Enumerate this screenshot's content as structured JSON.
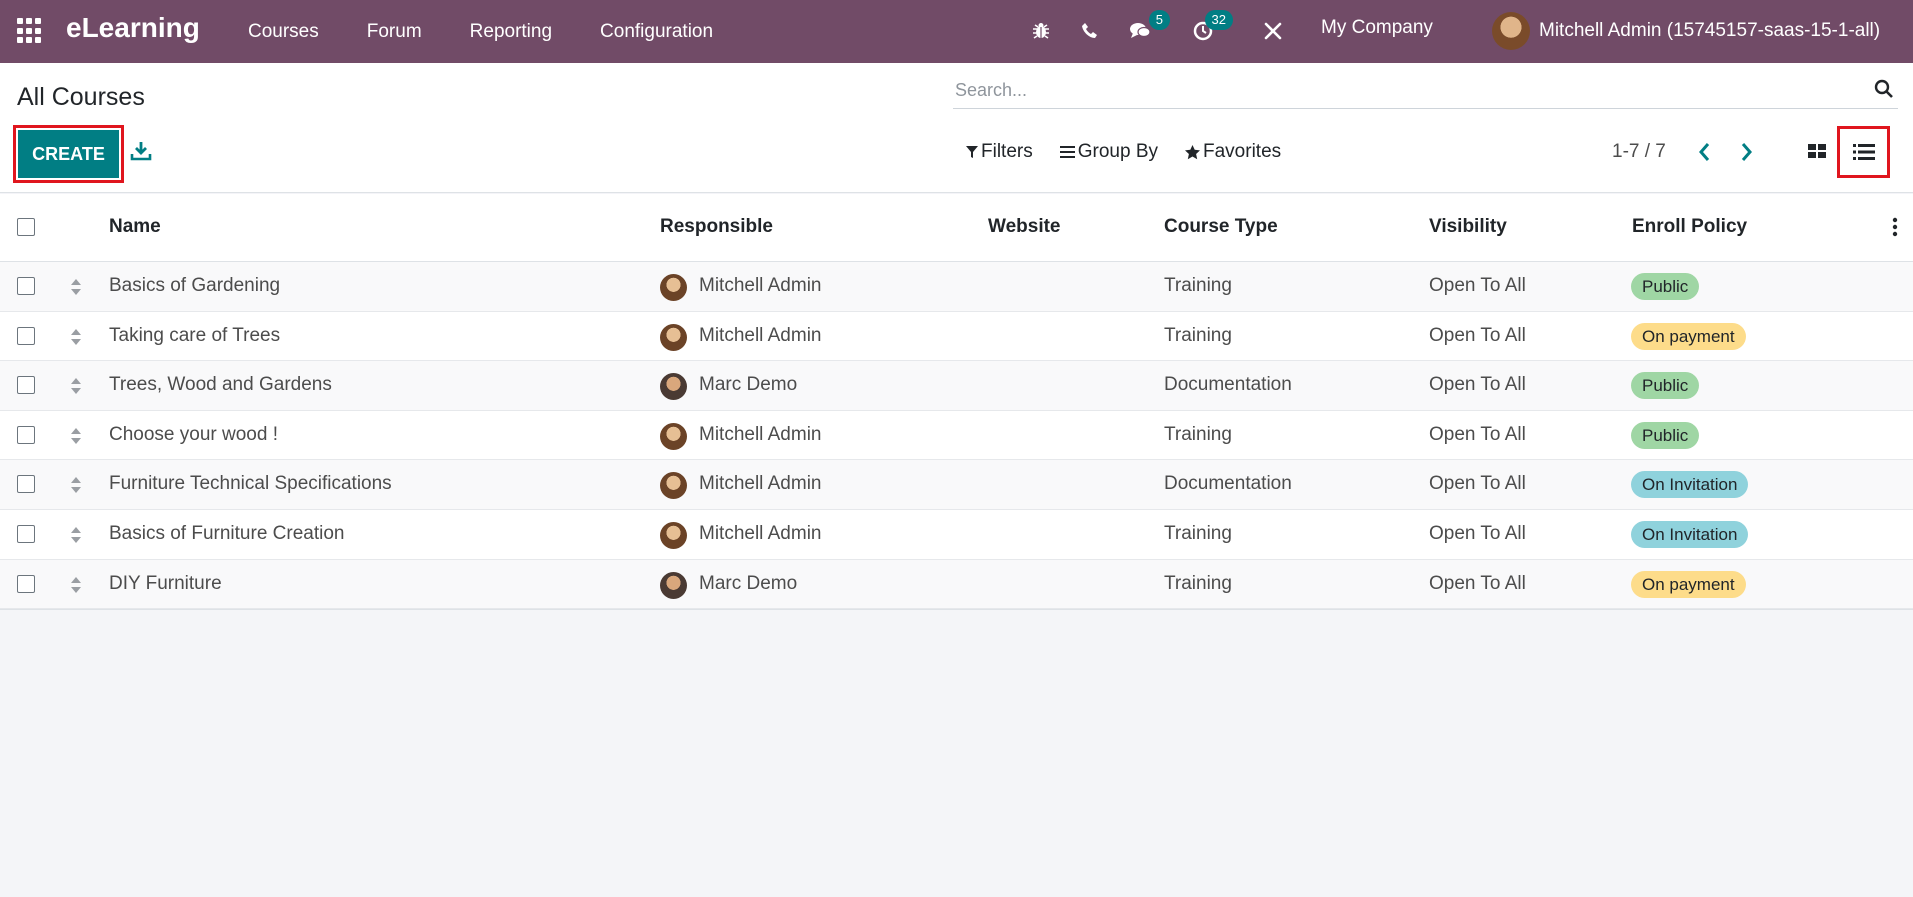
{
  "navbar": {
    "brand": "eLearning",
    "menu": [
      "Courses",
      "Forum",
      "Reporting",
      "Configuration"
    ],
    "messages_count": "5",
    "activities_count": "32",
    "company": "My Company",
    "user": "Mitchell Admin (15745157-saas-15-1-all)"
  },
  "control": {
    "title": "All Courses",
    "create_label": "CREATE",
    "search_placeholder": "Search...",
    "filters_label": "Filters",
    "groupby_label": "Group By",
    "favorites_label": "Favorites",
    "pager": "1-7 / 7"
  },
  "table": {
    "headers": {
      "name": "Name",
      "responsible": "Responsible",
      "website": "Website",
      "course_type": "Course Type",
      "visibility": "Visibility",
      "enroll_policy": "Enroll Policy"
    },
    "rows": [
      {
        "name": "Basics of Gardening",
        "responsible": "Mitchell Admin",
        "course_type": "Training",
        "visibility": "Open To All",
        "enroll": "Public"
      },
      {
        "name": "Taking care of Trees",
        "responsible": "Mitchell Admin",
        "course_type": "Training",
        "visibility": "Open To All",
        "enroll": "On payment"
      },
      {
        "name": "Trees, Wood and Gardens",
        "responsible": "Marc Demo",
        "course_type": "Documentation",
        "visibility": "Open To All",
        "enroll": "Public"
      },
      {
        "name": "Choose your wood !",
        "responsible": "Mitchell Admin",
        "course_type": "Training",
        "visibility": "Open To All",
        "enroll": "Public"
      },
      {
        "name": "Furniture Technical Specifications",
        "responsible": "Mitchell Admin",
        "course_type": "Documentation",
        "visibility": "Open To All",
        "enroll": "On Invitation"
      },
      {
        "name": "Basics of Furniture Creation",
        "responsible": "Mitchell Admin",
        "course_type": "Training",
        "visibility": "Open To All",
        "enroll": "On Invitation"
      },
      {
        "name": "DIY Furniture",
        "responsible": "Marc Demo",
        "course_type": "Training",
        "visibility": "Open To All",
        "enroll": "On payment"
      }
    ]
  },
  "colors": {
    "navbar": "#714b67",
    "primary": "#017e84",
    "pill_public": "#9fd6a4",
    "pill_payment": "#fddc8a",
    "pill_invitation": "#8fd2dc",
    "highlight": "#e0161e"
  }
}
